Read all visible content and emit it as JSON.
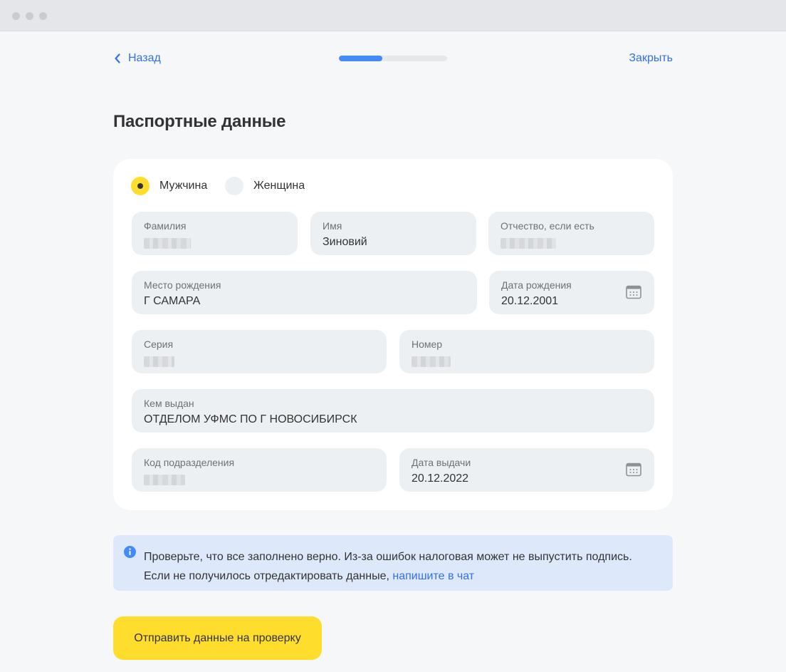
{
  "nav": {
    "back_label": "Назад",
    "close_label": "Закрыть",
    "progress_fraction": 0.4
  },
  "page_title": "Паспортные данные",
  "gender": {
    "male_label": "Мужчина",
    "female_label": "Женщина",
    "selected": "male"
  },
  "fields": {
    "last_name": {
      "label": "Фамилия",
      "value": ""
    },
    "first_name": {
      "label": "Имя",
      "value": "Зиновий"
    },
    "patronymic": {
      "label": "Отчество, если есть",
      "value": ""
    },
    "birth_place": {
      "label": "Место рождения",
      "value": "Г САМАРА"
    },
    "birth_date": {
      "label": "Дата рождения",
      "value": "20.12.2001"
    },
    "series": {
      "label": "Серия",
      "value": ""
    },
    "number": {
      "label": "Номер",
      "value": ""
    },
    "issued_by": {
      "label": "Кем выдан",
      "value": "ОТДЕЛОМ УФМС ПО Г НОВОСИБИРСК"
    },
    "division_code": {
      "label": "Код подразделения",
      "value": ""
    },
    "issue_date": {
      "label": "Дата выдачи",
      "value": "20.12.2022"
    }
  },
  "info": {
    "line1": "Проверьте, что все заполнено верно. Из-за ошибок налоговая может не выпустить подпись.",
    "line2_prefix": "Если не получилось отредактировать данные, ",
    "link": "напишите в чат"
  },
  "submit_label": "Отправить данные на проверку",
  "colors": {
    "accent_yellow": "#ffdd2d",
    "link_blue": "#336fee",
    "progress_blue": "#428bf9",
    "info_bg": "#dde9fb",
    "field_bg": "#edf0f3"
  },
  "icons": {
    "back": "chevron-left-icon",
    "calendar": "calendar-icon",
    "info": "info-icon"
  }
}
